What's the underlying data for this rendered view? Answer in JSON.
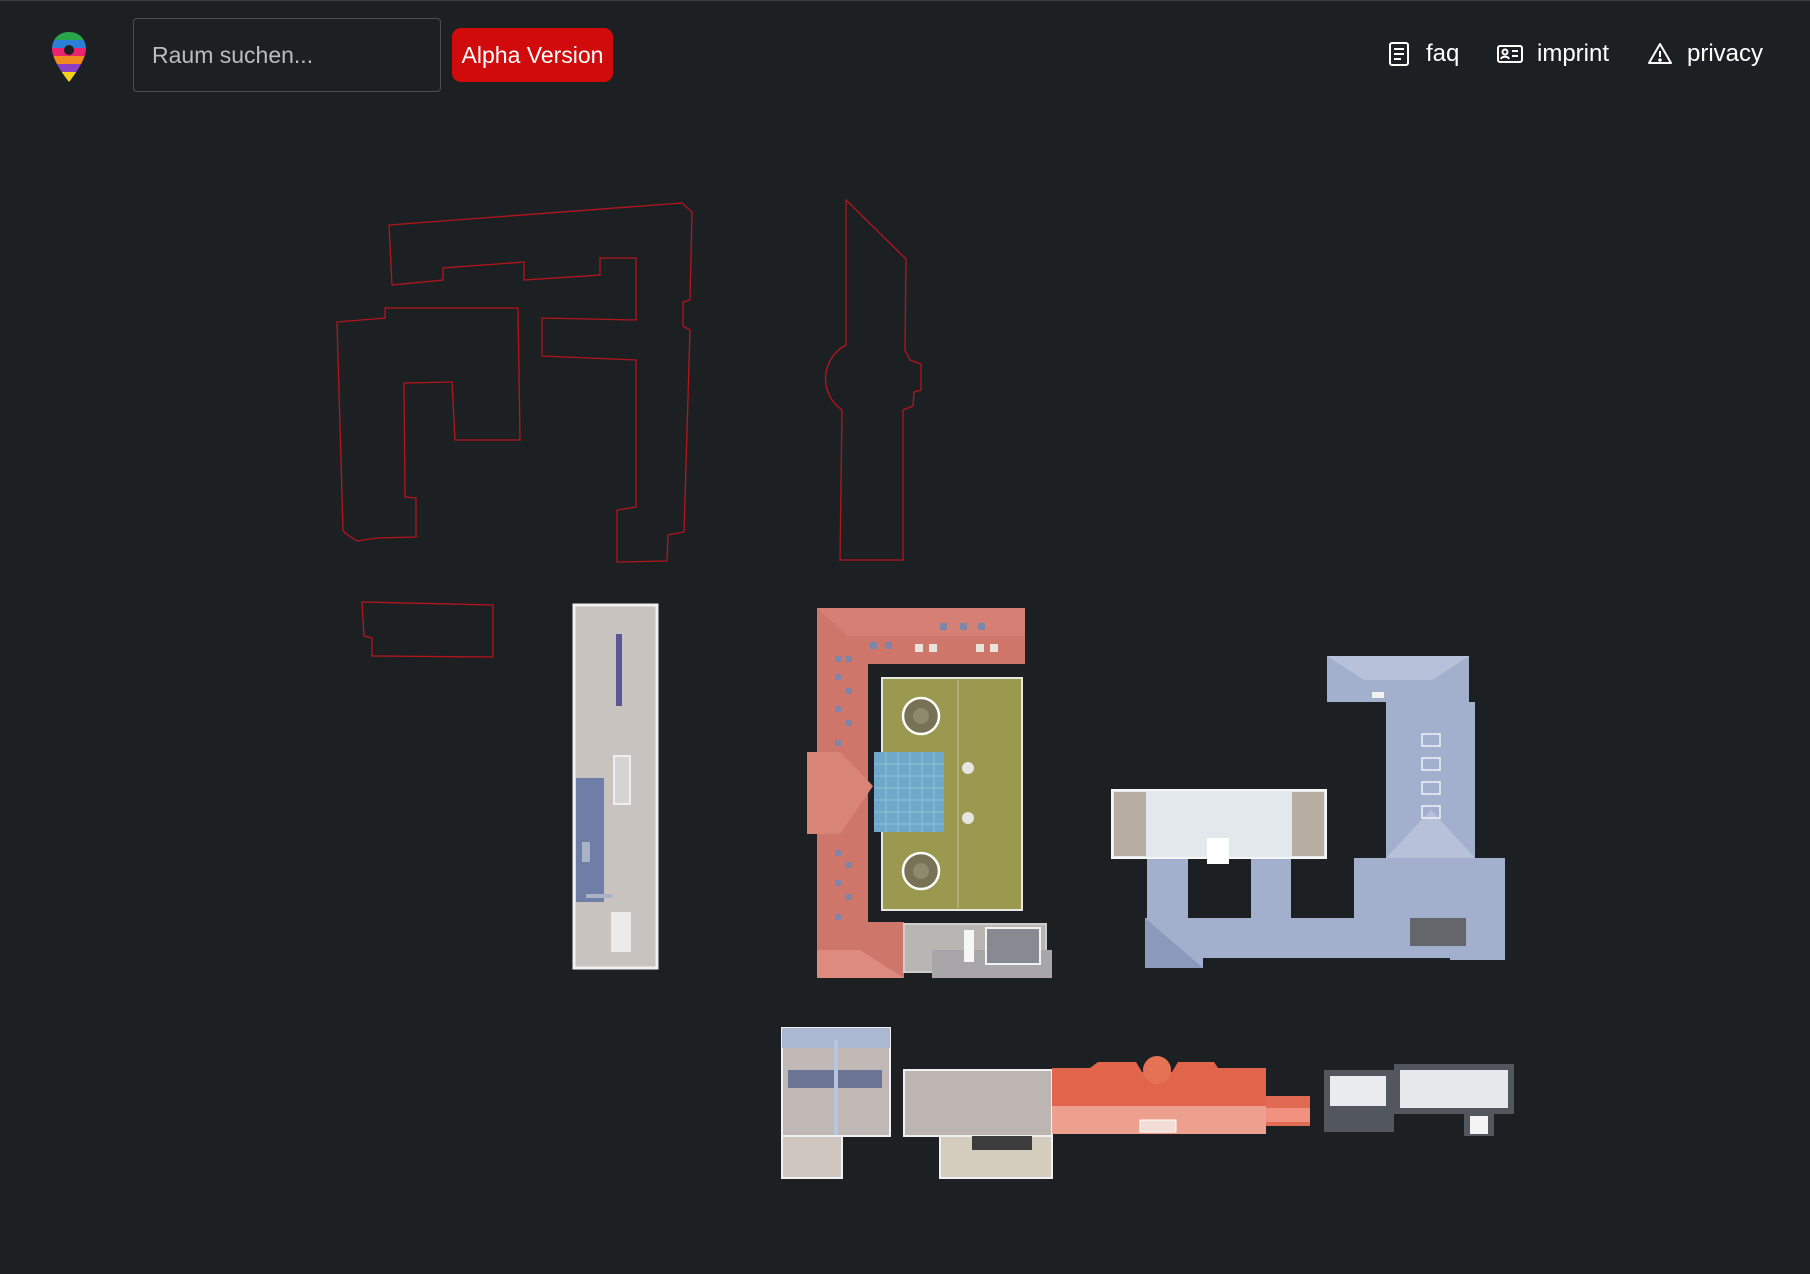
{
  "header": {
    "search_placeholder": "Raum suchen...",
    "alpha_label": "Alpha Version",
    "nav": {
      "faq": "faq",
      "imprint": "imprint",
      "privacy": "privacy"
    }
  },
  "colors": {
    "background": "#1d2023",
    "alpha_badge": "#d10b0b",
    "outline": "#b3151b",
    "building_red": "#cf766b",
    "building_blue": "#a3b0cd",
    "courtyard": "#9b994f",
    "glass_roof": "#6fa8c8",
    "orange_roof": "#e0654a"
  },
  "icons": {
    "logo": "map-pin-logo",
    "faq": "document-icon",
    "imprint": "id-card-icon",
    "privacy": "warning-triangle-icon"
  }
}
